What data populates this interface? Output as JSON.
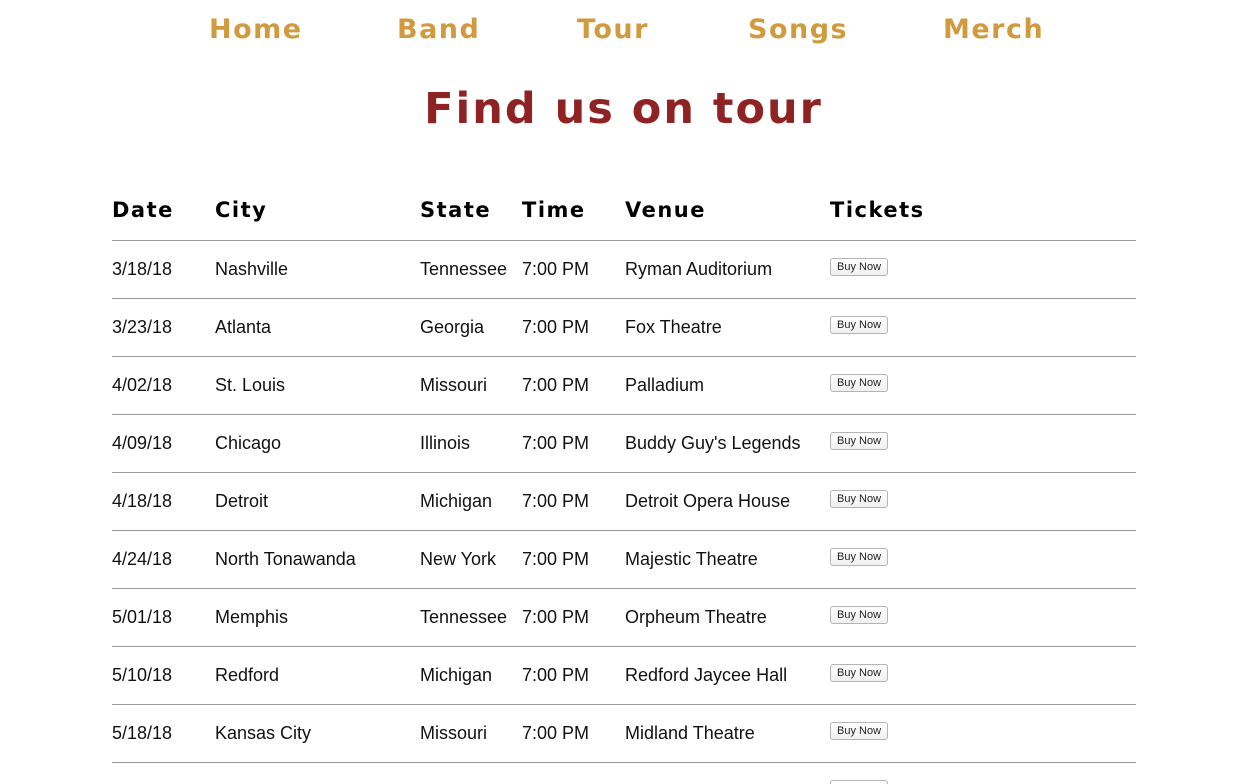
{
  "nav": {
    "items": [
      "Home",
      "Band",
      "Tour",
      "Songs",
      "Merch"
    ],
    "color": "#d19a3f"
  },
  "page": {
    "title": "Find us on tour",
    "title_color": "#8f2323"
  },
  "table": {
    "headers": [
      "Date",
      "City",
      "State",
      "Time",
      "Venue",
      "Tickets"
    ],
    "rows": [
      {
        "date": "3/18/18",
        "city": "Nashville",
        "state": "Tennessee",
        "time": "7:00 PM",
        "venue": "Ryman Auditorium",
        "ticket_label": "Buy Now"
      },
      {
        "date": "3/23/18",
        "city": "Atlanta",
        "state": "Georgia",
        "time": "7:00 PM",
        "venue": "Fox Theatre",
        "ticket_label": "Buy Now"
      },
      {
        "date": "4/02/18",
        "city": "St. Louis",
        "state": "Missouri",
        "time": "7:00 PM",
        "venue": "Palladium",
        "ticket_label": "Buy Now"
      },
      {
        "date": "4/09/18",
        "city": "Chicago",
        "state": "Illinois",
        "time": "7:00 PM",
        "venue": "Buddy Guy's Legends",
        "ticket_label": "Buy Now"
      },
      {
        "date": "4/18/18",
        "city": "Detroit",
        "state": "Michigan",
        "time": "7:00 PM",
        "venue": "Detroit Opera House",
        "ticket_label": "Buy Now"
      },
      {
        "date": "4/24/18",
        "city": "North Tonawanda",
        "state": "New York",
        "time": "7:00 PM",
        "venue": "Majestic Theatre",
        "ticket_label": "Buy Now"
      },
      {
        "date": "5/01/18",
        "city": "Memphis",
        "state": "Tennessee",
        "time": "7:00 PM",
        "venue": "Orpheum Theatre",
        "ticket_label": "Buy Now"
      },
      {
        "date": "5/10/18",
        "city": "Redford",
        "state": "Michigan",
        "time": "7:00 PM",
        "venue": "Redford Jaycee Hall",
        "ticket_label": "Buy Now"
      },
      {
        "date": "5/18/18",
        "city": "Kansas City",
        "state": "Missouri",
        "time": "7:00 PM",
        "venue": "Midland Theatre",
        "ticket_label": "Buy Now"
      },
      {
        "date": "",
        "city": "",
        "state": "",
        "time": "",
        "venue": "",
        "ticket_label": "Buy Now"
      }
    ]
  }
}
